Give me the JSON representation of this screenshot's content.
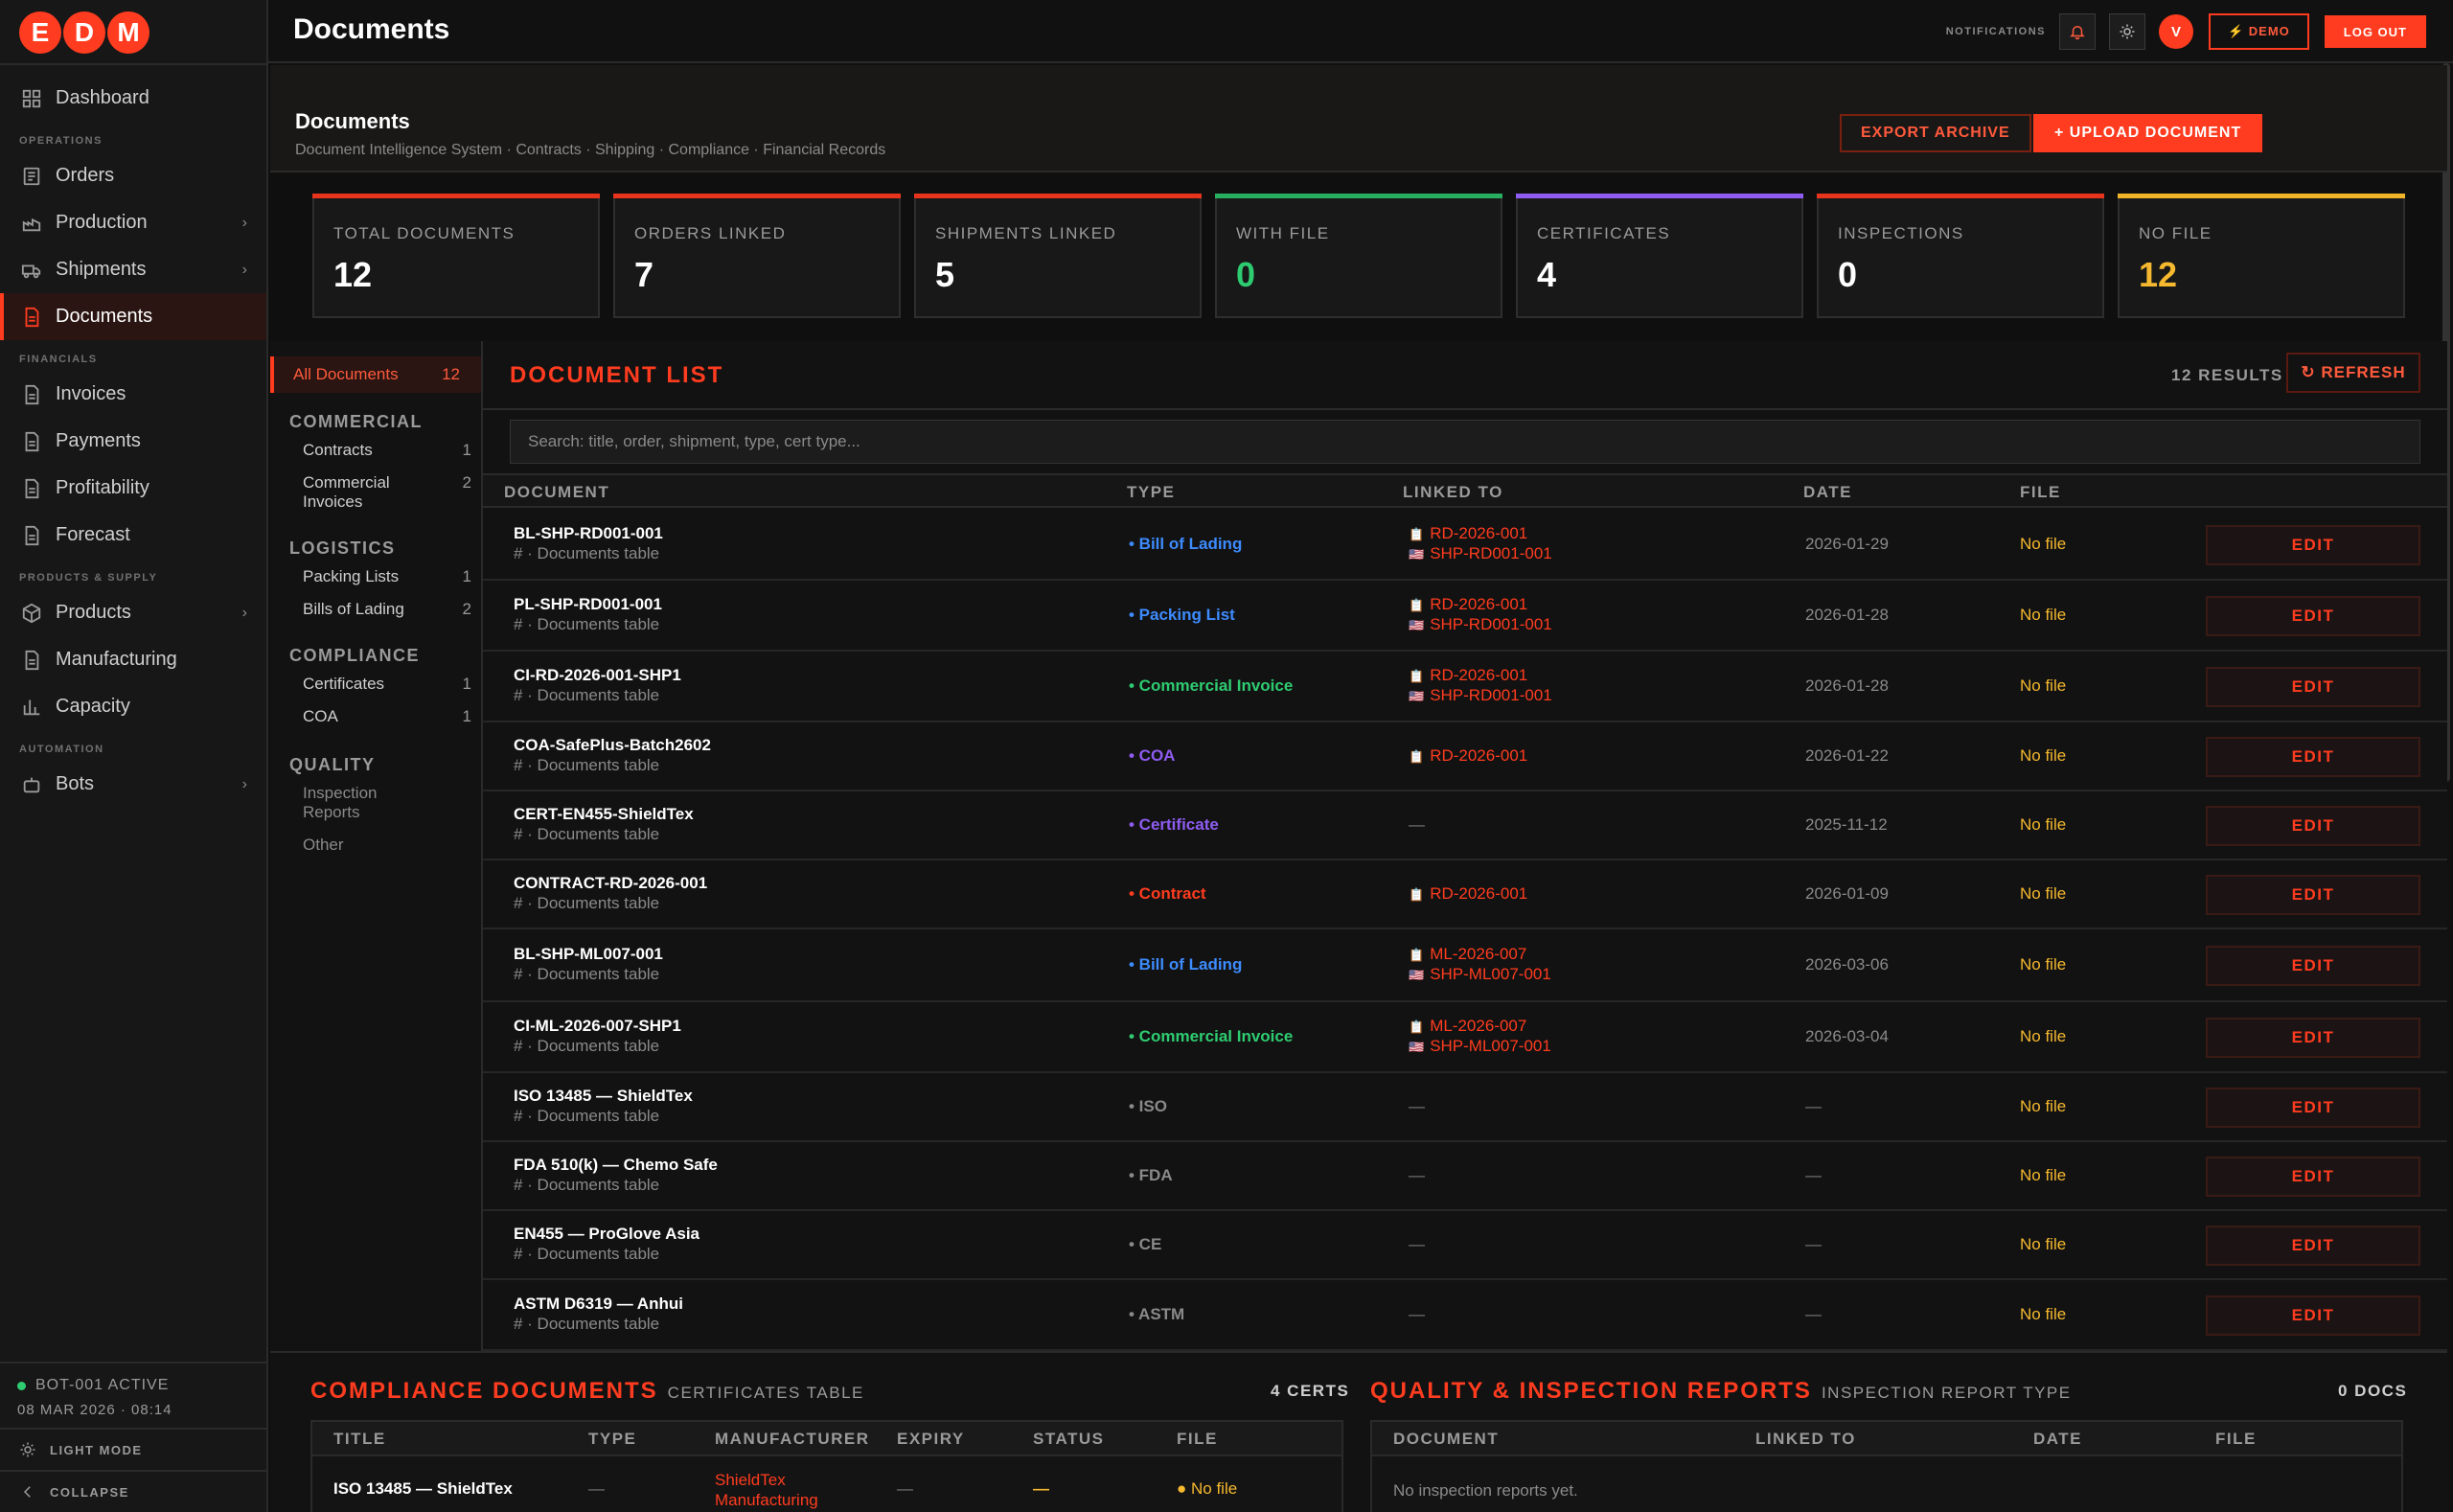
{
  "logo": [
    "E",
    "D",
    "M"
  ],
  "sidebar": {
    "items": [
      {
        "label": "Dashboard",
        "icon": "grid-icon"
      },
      {
        "section": "OPERATIONS"
      },
      {
        "label": "Orders",
        "icon": "list-icon"
      },
      {
        "label": "Production",
        "icon": "factory-icon",
        "chevron": "›"
      },
      {
        "label": "Shipments",
        "icon": "truck-icon",
        "chevron": "›"
      },
      {
        "label": "Documents",
        "icon": "document-icon",
        "active": true
      },
      {
        "section": "FINANCIALS"
      },
      {
        "label": "Invoices",
        "icon": "document-icon"
      },
      {
        "label": "Payments",
        "icon": "document-icon"
      },
      {
        "label": "Profitability",
        "icon": "document-icon"
      },
      {
        "label": "Forecast",
        "icon": "document-icon"
      },
      {
        "section": "PRODUCTS & SUPPLY"
      },
      {
        "label": "Products",
        "icon": "box-icon",
        "chevron": "›"
      },
      {
        "label": "Manufacturing",
        "icon": "document-icon"
      },
      {
        "label": "Capacity",
        "icon": "bar-chart-icon"
      },
      {
        "section": "AUTOMATION"
      },
      {
        "label": "Bots",
        "icon": "robot-icon",
        "chevron": "›"
      }
    ],
    "bot_status": "BOT-001 ACTIVE",
    "datetime": "08 MAR 2026 · 08:14",
    "light_mode": "LIGHT MODE",
    "collapse": "COLLAPSE"
  },
  "topbar": {
    "title": "Documents",
    "notifications_label": "NOTIFICATIONS",
    "avatar": "V",
    "demo": "⚡ DEMO",
    "logout": "LOG OUT"
  },
  "header": {
    "title": "Documents",
    "subtitle": "Document Intelligence System · Contracts · Shipping · Compliance · Financial Records",
    "export": "EXPORT ARCHIVE",
    "upload": "+ UPLOAD DOCUMENT"
  },
  "stats": [
    {
      "label": "TOTAL DOCUMENTS",
      "value": "12",
      "color": "#e8341c",
      "valColor": "#ffffff"
    },
    {
      "label": "ORDERS LINKED",
      "value": "7",
      "color": "#e8341c",
      "valColor": "#ffffff"
    },
    {
      "label": "SHIPMENTS LINKED",
      "value": "5",
      "color": "#e8341c",
      "valColor": "#ffffff"
    },
    {
      "label": "WITH FILE",
      "value": "0",
      "color": "#27ae60",
      "valColor": "#2ecc71"
    },
    {
      "label": "CERTIFICATES",
      "value": "4",
      "color": "#8e5cf0",
      "valColor": "#ffffff"
    },
    {
      "label": "INSPECTIONS",
      "value": "0",
      "color": "#e8341c",
      "valColor": "#ffffff"
    },
    {
      "label": "NO FILE",
      "value": "12",
      "color": "#f0b429",
      "valColor": "#f5b82e"
    }
  ],
  "categories": {
    "all": {
      "label": "All Documents",
      "count": "12"
    },
    "groups": [
      {
        "heading": "COMMERCIAL",
        "items": [
          {
            "label": "Contracts",
            "count": "1"
          },
          {
            "label": "Commercial Invoices",
            "count": "2"
          }
        ]
      },
      {
        "heading": "LOGISTICS",
        "items": [
          {
            "label": "Packing Lists",
            "count": "1"
          },
          {
            "label": "Bills of Lading",
            "count": "2"
          }
        ]
      },
      {
        "heading": "COMPLIANCE",
        "items": [
          {
            "label": "Certificates",
            "count": "1"
          },
          {
            "label": "COA",
            "count": "1"
          }
        ]
      },
      {
        "heading": "QUALITY",
        "items": [
          {
            "label": "Inspection Reports",
            "count": ""
          },
          {
            "label": "Other",
            "count": ""
          }
        ]
      }
    ]
  },
  "doclist": {
    "title": "DOCUMENT LIST",
    "results": "12 RESULTS",
    "refresh": "↻ REFRESH",
    "search_placeholder": "Search: title, order, shipment, type, cert type...",
    "columns": [
      "DOCUMENT",
      "TYPE",
      "LINKED TO",
      "DATE",
      "FILE"
    ],
    "edit_label": "EDIT",
    "rows": [
      {
        "title": "BL-SHP-RD001-001",
        "sub": "# · Documents table",
        "type": "Bill of Lading",
        "typeColor": "#3d8bfd",
        "links": [
          "RD-2026-001",
          "SHP-RD001-001"
        ],
        "date": "2026-01-29",
        "file": "No file"
      },
      {
        "title": "PL-SHP-RD001-001",
        "sub": "# · Documents table",
        "type": "Packing List",
        "typeColor": "#3d8bfd",
        "links": [
          "RD-2026-001",
          "SHP-RD001-001"
        ],
        "date": "2026-01-28",
        "file": "No file"
      },
      {
        "title": "CI-RD-2026-001-SHP1",
        "sub": "# · Documents table",
        "type": "Commercial Invoice",
        "typeColor": "#2ecc71",
        "links": [
          "RD-2026-001",
          "SHP-RD001-001"
        ],
        "date": "2026-01-28",
        "file": "No file"
      },
      {
        "title": "COA-SafePlus-Batch2602",
        "sub": "# · Documents table",
        "type": "COA",
        "typeColor": "#8e5cf0",
        "links": [
          "RD-2026-001"
        ],
        "date": "2026-01-22",
        "file": "No file"
      },
      {
        "title": "CERT-EN455-ShieldTex",
        "sub": "# · Documents table",
        "type": "Certificate",
        "typeColor": "#8e5cf0",
        "links": [],
        "date": "2025-11-12",
        "file": "No file"
      },
      {
        "title": "CONTRACT-RD-2026-001",
        "sub": "# · Documents table",
        "type": "Contract",
        "typeColor": "#ff3c1f",
        "links": [
          "RD-2026-001"
        ],
        "date": "2026-01-09",
        "file": "No file"
      },
      {
        "title": "BL-SHP-ML007-001",
        "sub": "# · Documents table",
        "type": "Bill of Lading",
        "typeColor": "#3d8bfd",
        "links": [
          "ML-2026-007",
          "SHP-ML007-001"
        ],
        "date": "2026-03-06",
        "file": "No file"
      },
      {
        "title": "CI-ML-2026-007-SHP1",
        "sub": "# · Documents table",
        "type": "Commercial Invoice",
        "typeColor": "#2ecc71",
        "links": [
          "ML-2026-007",
          "SHP-ML007-001"
        ],
        "date": "2026-03-04",
        "file": "No file"
      },
      {
        "title": "ISO 13485 — ShieldTex",
        "sub": "# · Documents table",
        "type": "ISO",
        "typeColor": "#8a8a8a",
        "links": [],
        "date": "—",
        "file": "No file"
      },
      {
        "title": "FDA 510(k) — Chemo Safe",
        "sub": "# · Documents table",
        "type": "FDA",
        "typeColor": "#8a8a8a",
        "links": [],
        "date": "—",
        "file": "No file"
      },
      {
        "title": "EN455 — ProGlove Asia",
        "sub": "# · Documents table",
        "type": "CE",
        "typeColor": "#8a8a8a",
        "links": [],
        "date": "—",
        "file": "No file"
      },
      {
        "title": "ASTM D6319 — Anhui",
        "sub": "# · Documents table",
        "type": "ASTM",
        "typeColor": "#8a8a8a",
        "links": [],
        "date": "—",
        "file": "No file"
      }
    ]
  },
  "compliance": {
    "title": "COMPLIANCE DOCUMENTS",
    "subtitle": "CERTIFICATES TABLE",
    "count": "4 CERTS",
    "columns": [
      "TITLE",
      "TYPE",
      "MANUFACTURER",
      "EXPIRY",
      "STATUS",
      "FILE"
    ],
    "row": {
      "title": "ISO 13485 — ShieldTex",
      "type": "—",
      "manufacturer": "ShieldTex Manufacturing",
      "expiry": "—",
      "status": "—",
      "file": "● No file"
    }
  },
  "quality": {
    "title": "QUALITY & INSPECTION REPORTS",
    "subtitle": "INSPECTION REPORT TYPE",
    "count": "0 DOCS",
    "columns": [
      "DOCUMENT",
      "LINKED TO",
      "DATE",
      "FILE"
    ],
    "empty": "No inspection reports yet."
  }
}
